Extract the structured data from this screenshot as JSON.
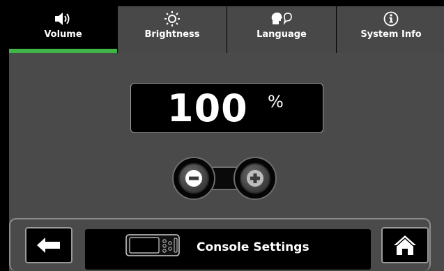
{
  "tabs": [
    {
      "label": "Volume",
      "icon": "speaker-icon",
      "active": true
    },
    {
      "label": "Brightness",
      "icon": "sun-icon",
      "active": false
    },
    {
      "label": "Language",
      "icon": "speaking-head-icon",
      "active": false
    },
    {
      "label": "System Info",
      "icon": "info-icon",
      "active": false
    }
  ],
  "volume": {
    "value": "100",
    "unit": "%"
  },
  "stepper": {
    "decrease_icon": "minus-icon",
    "increase_icon": "plus-icon"
  },
  "footer": {
    "title": "Console Settings",
    "back_icon": "arrow-left-icon",
    "home_icon": "home-icon",
    "console_icon": "console-device-icon"
  },
  "colors": {
    "active_tab_indicator": "#3fb54a",
    "background": "#4a4a4a"
  }
}
